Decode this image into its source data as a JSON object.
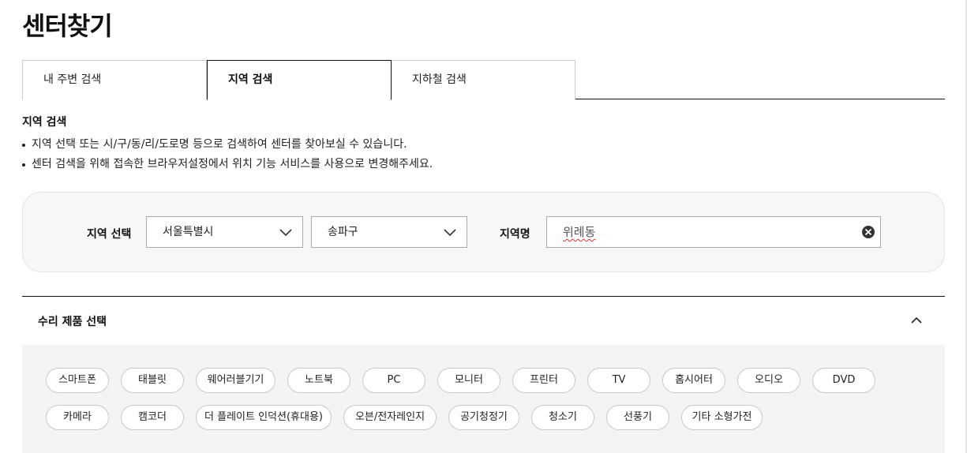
{
  "page_title": "센터찾기",
  "tabs": [
    {
      "label": "내 주변 검색"
    },
    {
      "label": "지역 검색"
    },
    {
      "label": "지하철 검색"
    }
  ],
  "active_tab": "지역 검색",
  "section": {
    "title": "지역 검색",
    "bullets": [
      "지역 선택 또는 시/구/동/리/도로명 등으로 검색하여 센터를 찾아보실 수 있습니다.",
      "센터 검색을 위해 접속한 브라우저설정에서 위치 기능 서비스를 사용으로 변경해주세요."
    ]
  },
  "search": {
    "region_label": "지역 선택",
    "city_value": "서울특별시",
    "district_value": "송파구",
    "name_label": "지역명",
    "name_value": "위례동"
  },
  "products": {
    "title": "수리 제품 선택",
    "expanded": true,
    "items": [
      "스마트폰",
      "태블릿",
      "웨어러블기기",
      "노트북",
      "PC",
      "모니터",
      "프린터",
      "TV",
      "홈시어터",
      "오디오",
      "DVD",
      "카메라",
      "캠코더",
      "더 플레이트 인덕션(휴대용)",
      "오븐/전자레인지",
      "공기청정기",
      "청소기",
      "선풍기",
      "기타 소형가전"
    ]
  },
  "icons": {
    "select_arrow": "chevron-down-icon",
    "clear": "clear-circle-icon",
    "collapse": "chevron-up-icon"
  }
}
